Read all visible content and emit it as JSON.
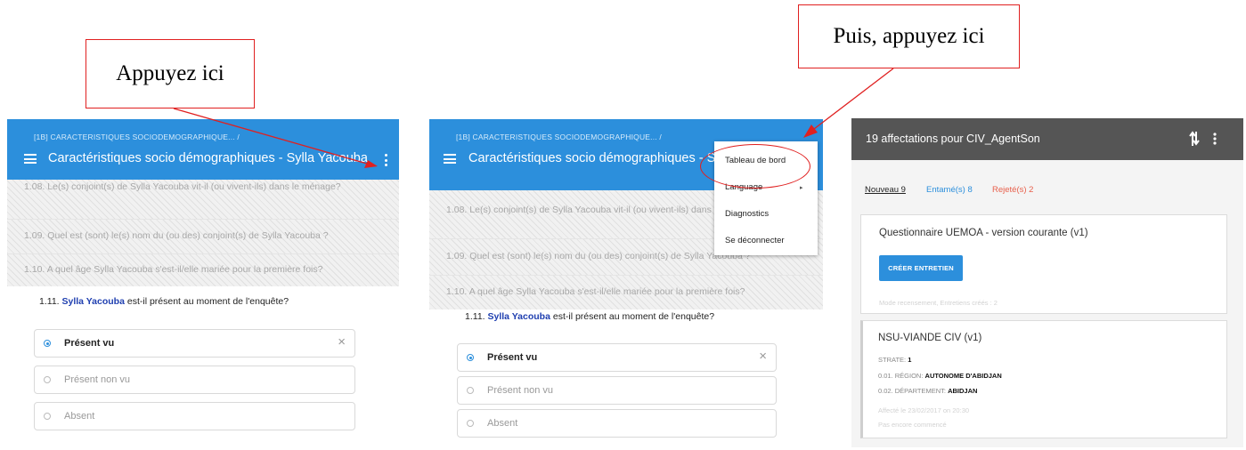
{
  "callouts": {
    "first": "Appuyez ici",
    "second": "Puis, appuyez ici"
  },
  "survey": {
    "breadcrumb": "[1B] CARACTERISTIQUES SOCIODEMOGRAPHIQUE...  /",
    "title": "Caractéristiques socio démographiques - Sylla Yacouba",
    "questions": [
      "1.08. Le(s) conjoint(s) de Sylla Yacouba vit-il (ou vivent-ils) dans le ménage?",
      "1.09. Quel est (sont) le(s) nom du (ou des) conjoint(s) de Sylla Yacouba ?",
      "1.10. A quel âge Sylla Yacouba s'est-il/elle mariée pour la première fois?"
    ],
    "current_question": {
      "number": "1.11.",
      "name": "Sylla Yacouba",
      "rest": "est-il présent au moment de l'enquête?"
    },
    "options": [
      {
        "label": "Présent vu",
        "selected": true
      },
      {
        "label": "Présent non vu",
        "selected": false
      },
      {
        "label": "Absent",
        "selected": false
      }
    ],
    "clear_symbol": "×"
  },
  "menu": {
    "items": [
      "Tableau de bord",
      "Language",
      "Diagnostics",
      "Se déconnecter"
    ],
    "submenu_arrow": "▸"
  },
  "dashboard": {
    "title": "19 affectations pour CIV_AgentSon",
    "tabs": {
      "new": "Nouveau 9",
      "started": "Entamé(s) 8",
      "rejected": "Rejeté(s) 2"
    },
    "questionnaire": {
      "title": "Questionnaire UEMOA - version courante (v1)",
      "button": "CRÉER ENTRETIEN",
      "footer": "Mode recensement, Entretiens créés : 2"
    },
    "assignment": {
      "title": "NSU-VIANDE CIV (v1)",
      "strate_label": "STRATE:",
      "strate_value": "1",
      "region_label": "0.01. RÉGION:",
      "region_value": "AUTONOME D'ABIDJAN",
      "departement_label": "0.02. DÉPARTEMENT:",
      "departement_value": "ABIDJAN",
      "assigned": "Affecté le 23/02/2017 on 20:30",
      "status": "Pas encore commencé"
    }
  },
  "colors": {
    "appbar_blue": "#2c8fdc",
    "dashboard_bar": "#555555",
    "annotation_red": "#e02020",
    "rejected_orange": "#e8604c",
    "name_highlight": "#1f3fb0"
  }
}
